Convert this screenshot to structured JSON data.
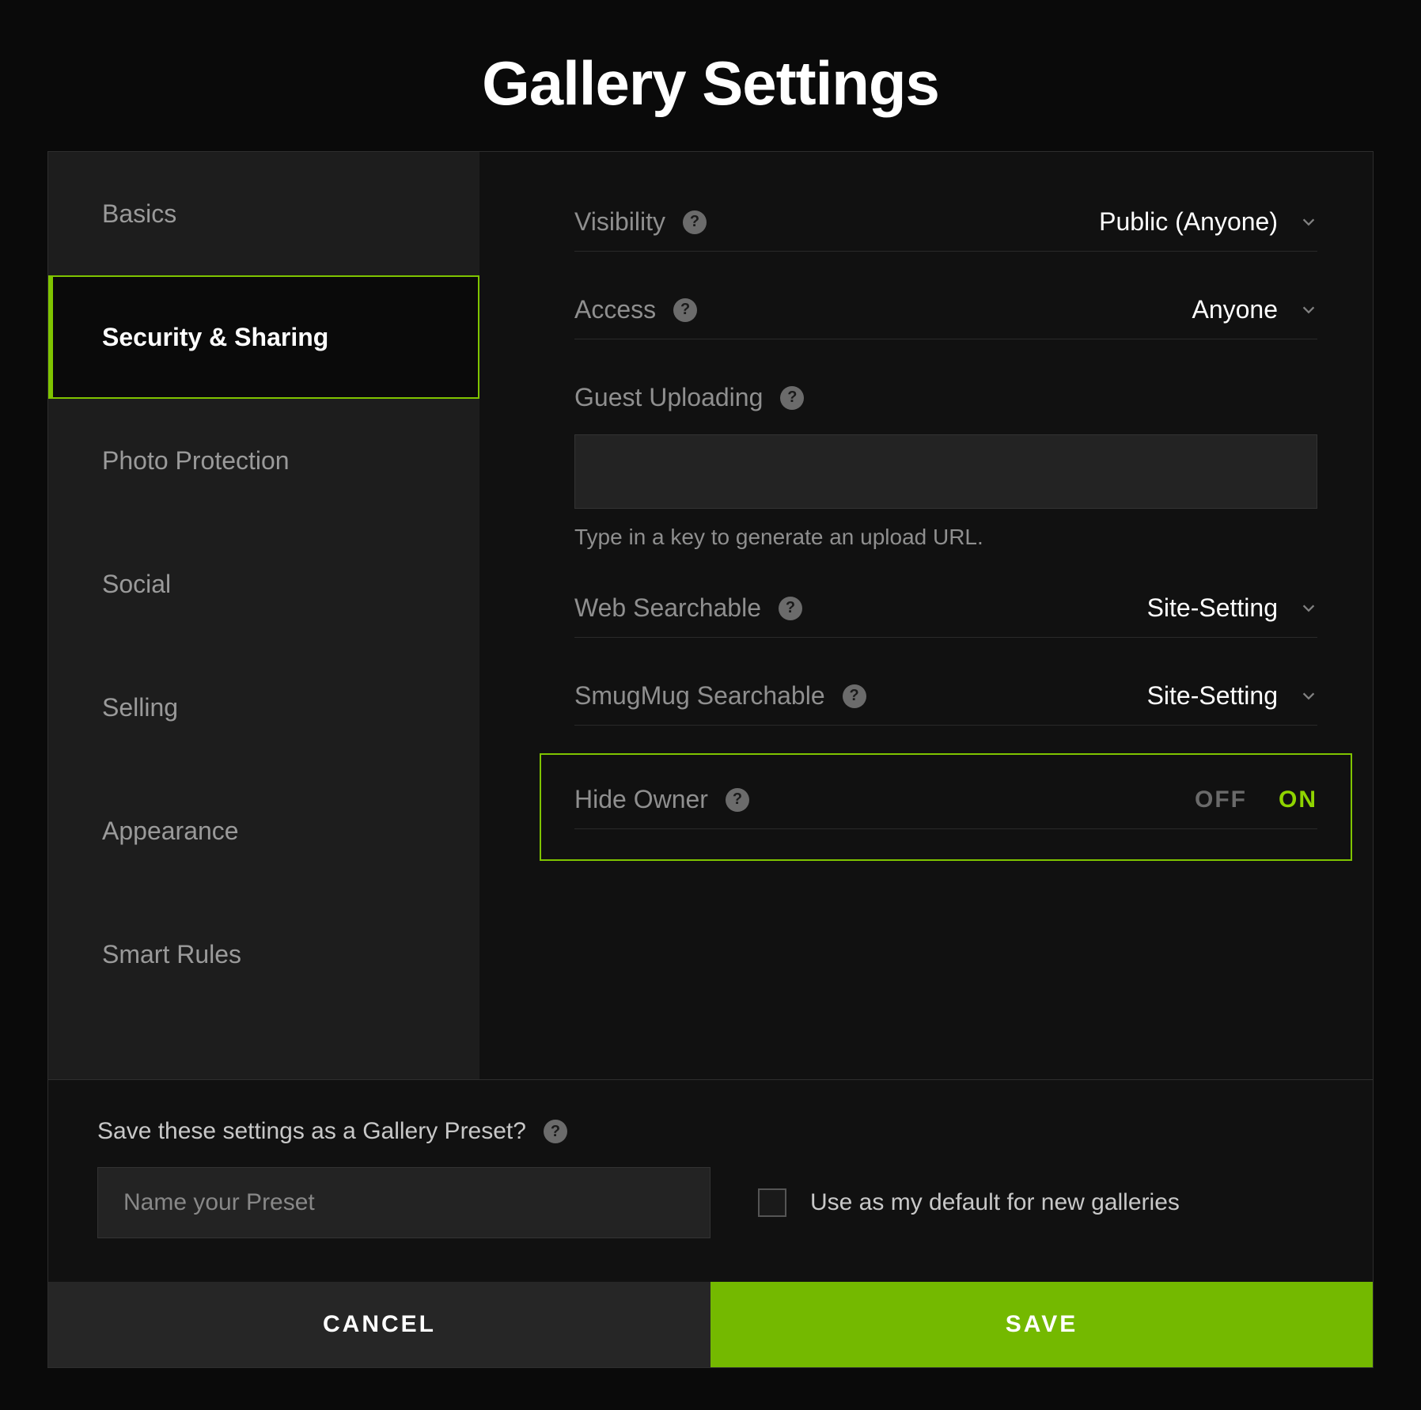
{
  "title": "Gallery Settings",
  "sidebar": {
    "items": [
      {
        "label": "Basics"
      },
      {
        "label": "Security & Sharing"
      },
      {
        "label": "Photo Protection"
      },
      {
        "label": "Social"
      },
      {
        "label": "Selling"
      },
      {
        "label": "Appearance"
      },
      {
        "label": "Smart Rules"
      }
    ],
    "active_index": 1
  },
  "settings": {
    "visibility": {
      "label": "Visibility",
      "value": "Public (Anyone)"
    },
    "access": {
      "label": "Access",
      "value": "Anyone"
    },
    "guest_uploading": {
      "label": "Guest Uploading",
      "hint": "Type in a key to generate an upload URL."
    },
    "web_searchable": {
      "label": "Web Searchable",
      "value": "Site-Setting"
    },
    "smugmug_searchable": {
      "label": "SmugMug Searchable",
      "value": "Site-Setting"
    },
    "hide_owner": {
      "label": "Hide Owner",
      "off": "OFF",
      "on": "ON",
      "state": "on"
    }
  },
  "preset": {
    "prompt": "Save these settings as a Gallery Preset?",
    "placeholder": "Name your Preset",
    "default_label": "Use as my default for new galleries"
  },
  "actions": {
    "cancel": "CANCEL",
    "save": "SAVE"
  },
  "glyphs": {
    "help": "?"
  }
}
